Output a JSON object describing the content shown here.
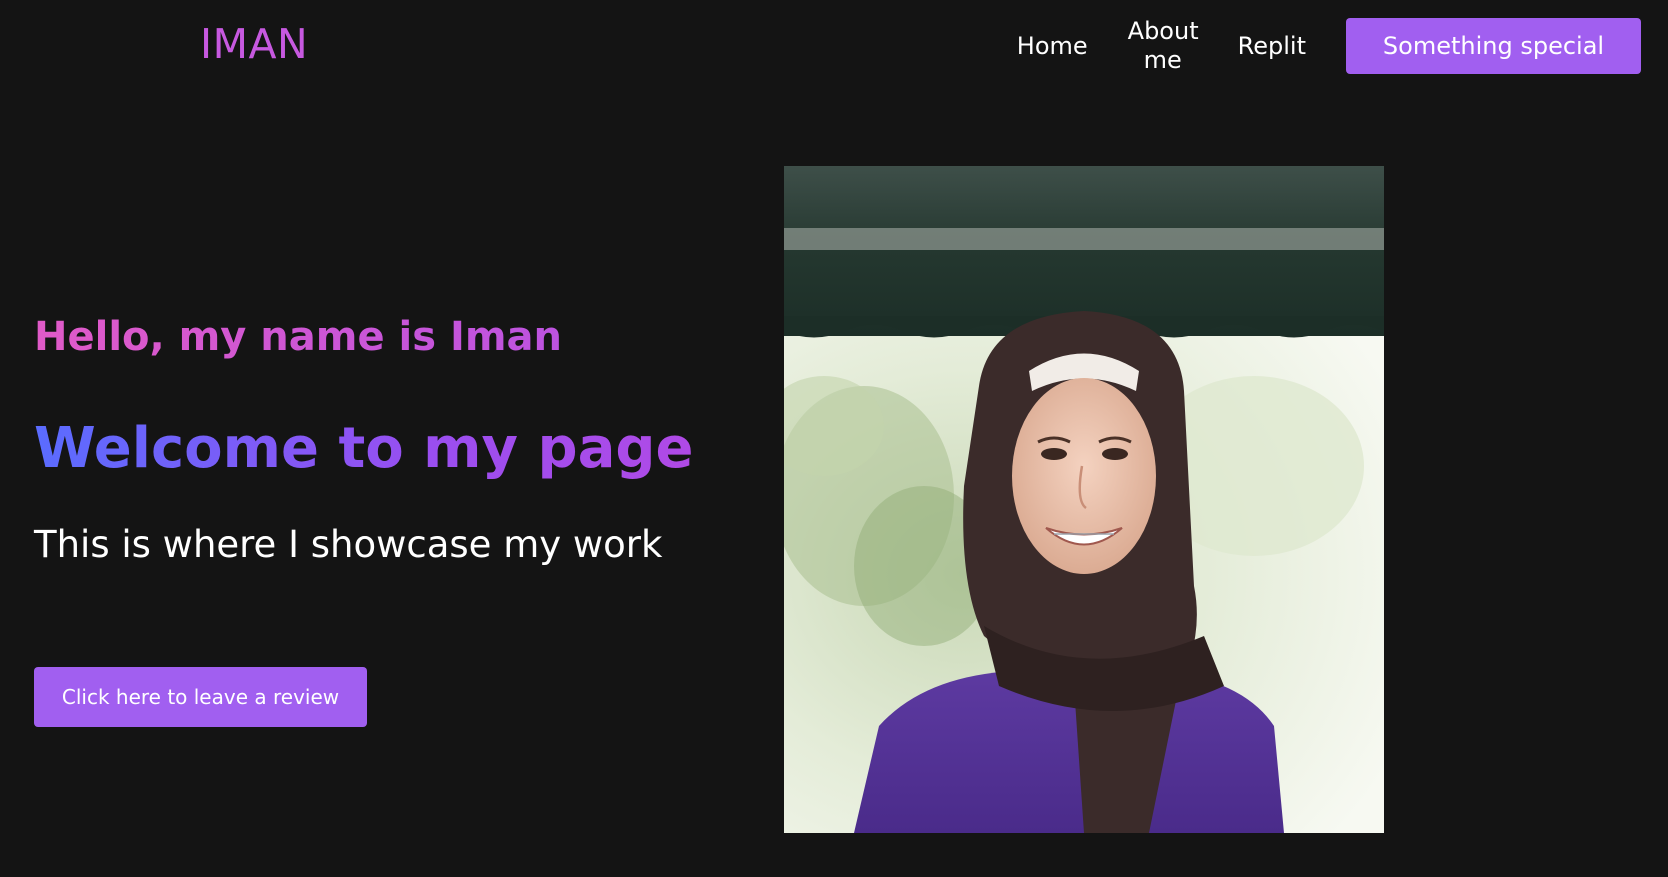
{
  "header": {
    "logo": "IMAN",
    "nav": [
      {
        "label": "Home"
      },
      {
        "label": "About me"
      },
      {
        "label": "Replit"
      }
    ],
    "cta_label": "Something special"
  },
  "hero": {
    "greeting": "Hello, my name is Iman",
    "headline": "Welcome to my page",
    "subtitle": "This is where I showcase my work",
    "review_button_label": "Click here to leave a review"
  },
  "colors": {
    "background": "#141414",
    "accent": "#a15ff0",
    "logo": "#c759e0"
  },
  "icons": {
    "portrait": "portrait-photo"
  }
}
